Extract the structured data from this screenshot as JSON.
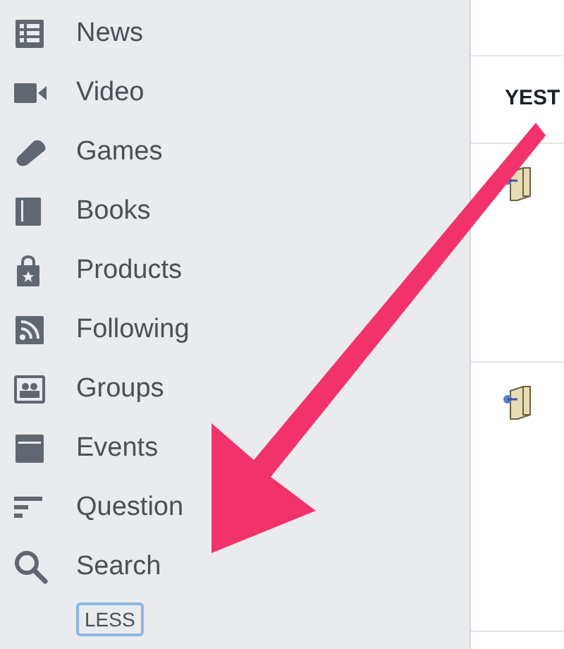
{
  "sidebar": {
    "items": [
      {
        "label": "News"
      },
      {
        "label": "Video"
      },
      {
        "label": "Games"
      },
      {
        "label": "Books"
      },
      {
        "label": "Products"
      },
      {
        "label": "Following"
      },
      {
        "label": "Groups"
      },
      {
        "label": "Events"
      },
      {
        "label": "Question"
      },
      {
        "label": "Search"
      }
    ],
    "toggle": "LESS"
  },
  "feed": {
    "header": "YEST"
  }
}
